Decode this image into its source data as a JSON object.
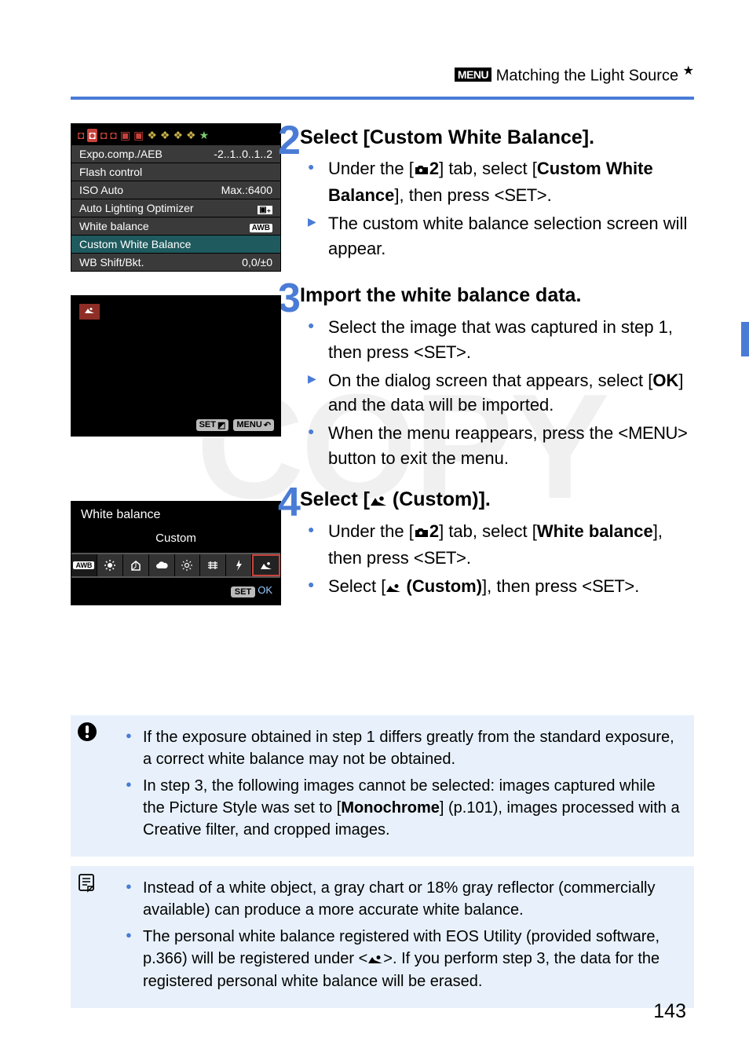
{
  "header": {
    "menu_badge": "MENU",
    "title": "Matching the Light Source",
    "star": "★"
  },
  "menu1": {
    "rows": [
      {
        "label": "Expo.comp./AEB",
        "value": "-2..1..0..1..2"
      },
      {
        "label": "Flash control",
        "value": ""
      },
      {
        "label": "ISO Auto",
        "value": "Max.:6400"
      },
      {
        "label": "Auto Lighting Optimizer",
        "value": ""
      },
      {
        "label": "White balance",
        "value": "AWB"
      },
      {
        "label": "Custom White Balance",
        "value": "",
        "sel": true
      },
      {
        "label": "WB Shift/Bkt.",
        "value": "0,0/±0"
      }
    ]
  },
  "ss2": {
    "set": "SET",
    "menu": "MENU"
  },
  "ss3": {
    "title": "White balance",
    "subtitle": "Custom",
    "set": "SET",
    "ok": "OK"
  },
  "step2": {
    "num": "2",
    "title": "Select [Custom White Balance].",
    "b1_a": "Under the [",
    "b1_tab": "2",
    "b1_b": "] tab, select [",
    "b1_c": "Custom White Balance",
    "b1_d": "], then press <",
    "b1_set": "SET",
    "b1_e": ">.",
    "b2": "The custom white balance selection screen will appear."
  },
  "step3": {
    "num": "3",
    "title": "Import the white balance data.",
    "b1_a": "Select the image that was captured in step 1, then press <",
    "b1_set": "SET",
    "b1_b": ">.",
    "b2_a": "On the dialog screen that appears, select [",
    "b2_ok": "OK",
    "b2_b": "] and the data will be imported.",
    "b3_a": "When the menu reappears, press the <",
    "b3_menu": "MENU",
    "b3_b": "> button to exit the menu."
  },
  "step4": {
    "num": "4",
    "title_a": "Select [",
    "title_b": " (Custom)].",
    "b1_a": "Under the [",
    "b1_tab": "2",
    "b1_b": "] tab, select [",
    "b1_c": "White balance",
    "b1_d": "], then press <",
    "b1_set": "SET",
    "b1_e": ">.",
    "b2_a": "Select [",
    "b2_b": " (Custom)",
    "b2_c": "], then press <",
    "b2_set": "SET",
    "b2_d": ">."
  },
  "note1": {
    "b1": "If the exposure obtained in step 1 differs greatly from the standard exposure, a correct white balance may not be obtained.",
    "b2_a": "In step 3, the following images cannot be selected: images captured while the Picture Style was set to [",
    "b2_mono": "Monochrome",
    "b2_b": "] (p.101), images processed with a Creative filter, and cropped images."
  },
  "note2": {
    "b1": "Instead of a white object, a gray chart or 18% gray reflector (commercially available) can produce a more accurate white balance.",
    "b2_a": "The personal white balance registered with EOS Utility (provided software, p.366) will be registered under <",
    "b2_b": ">. If you perform step 3, the data for the registered personal white balance will be erased."
  },
  "page_num": "143"
}
